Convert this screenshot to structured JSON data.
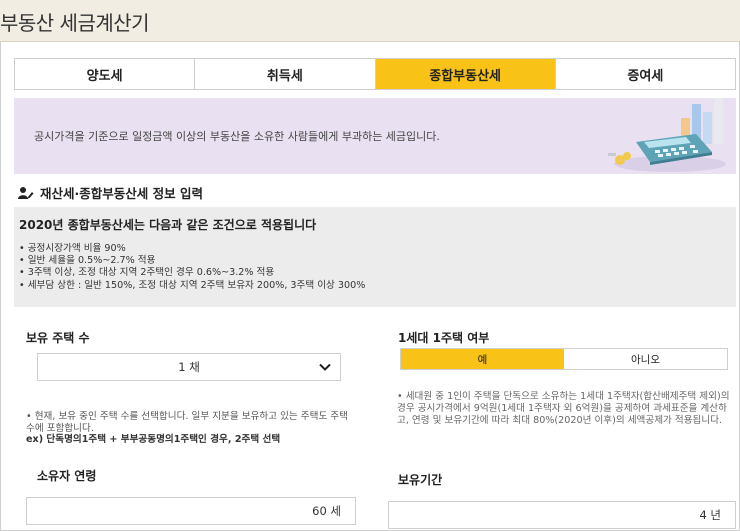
{
  "header": {
    "title": "부동산 세금계산기"
  },
  "tabs": [
    {
      "label": "양도세",
      "active": false
    },
    {
      "label": "취득세",
      "active": false
    },
    {
      "label": "종합부동산세",
      "active": true
    },
    {
      "label": "증여세",
      "active": false
    }
  ],
  "banner": {
    "text": "공시가격을 기준으로 일정금액 이상의 부동산을 소유한 사람들에게 부과하는 세금입니다."
  },
  "section": {
    "title": "재산세·종합부동산세 정보 입력",
    "icon": "user-edit-icon"
  },
  "conditions": {
    "heading": "2020년 종합부동산세는 다음과 같은 조건으로 적용됩니다",
    "items": [
      "공정시장가액 비율 90%",
      "일반 세율을 0.5%~2.7% 적용",
      "3주택 이상, 조정 대상 지역 2주택인 경우 0.6%~3.2% 적용",
      "세부담 상한 : 일반 150%, 조정 대상 지역 2주택 보유자 200%, 3주택 이상 300%"
    ]
  },
  "houses": {
    "label": "보유 주택 수",
    "selected": "1 채",
    "note": "• 현재, 보유 중인 주택 수를 선택합니다. 일부 지분을 보유하고 있는 주택도 주택 수에 포함합니다.",
    "example": "ex) 단독명의1주택 + 부부공동명의1주택인 경우, 2주택 선택"
  },
  "one_house": {
    "label": "1세대 1주택 여부",
    "yes": "예",
    "no": "아니오",
    "selected": "예",
    "note": "• 세대원 중 1인이 주택을 단독으로 소유하는 1세대 1주택자(합산배제주택 제외)의 경우 공시가격에서 9억원(1세대 1주택자 외 6억원)을 공제하여 과세표준을 계산하고, 연령 및 보유기간에 따라 최대 80%(2020년 이후)의 세액공제가 적용됩니다."
  },
  "age": {
    "label": "소유자 연령",
    "value": "60 세"
  },
  "period": {
    "label": "보유기간",
    "value": "4 년"
  },
  "colors": {
    "accent": "#f8c216",
    "banner_bg": "#e9e0f1",
    "header_bg": "#f2ede3"
  }
}
